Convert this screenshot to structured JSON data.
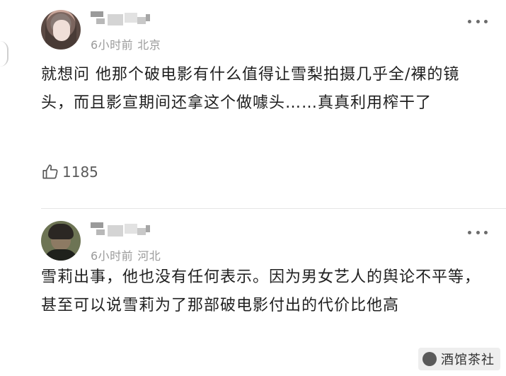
{
  "comments": [
    {
      "username_blurred": "",
      "time": "6小时前",
      "location": "北京",
      "text": "就想问 他那个破电影有什么值得让雪梨拍摄几乎全/裸的镜头，而且影宣期间还拿这个做噱头……真真利用榨干了",
      "likes": "1185"
    },
    {
      "username_blurred": "",
      "time": "6小时前",
      "location": "河北",
      "text": "雪莉出事，他也没有任何表示。因为男女艺人的舆论不平等，甚至可以说雪莉为了那部破电影付出的代价比他高"
    }
  ],
  "watermark": {
    "text": "酒馆茶社"
  }
}
